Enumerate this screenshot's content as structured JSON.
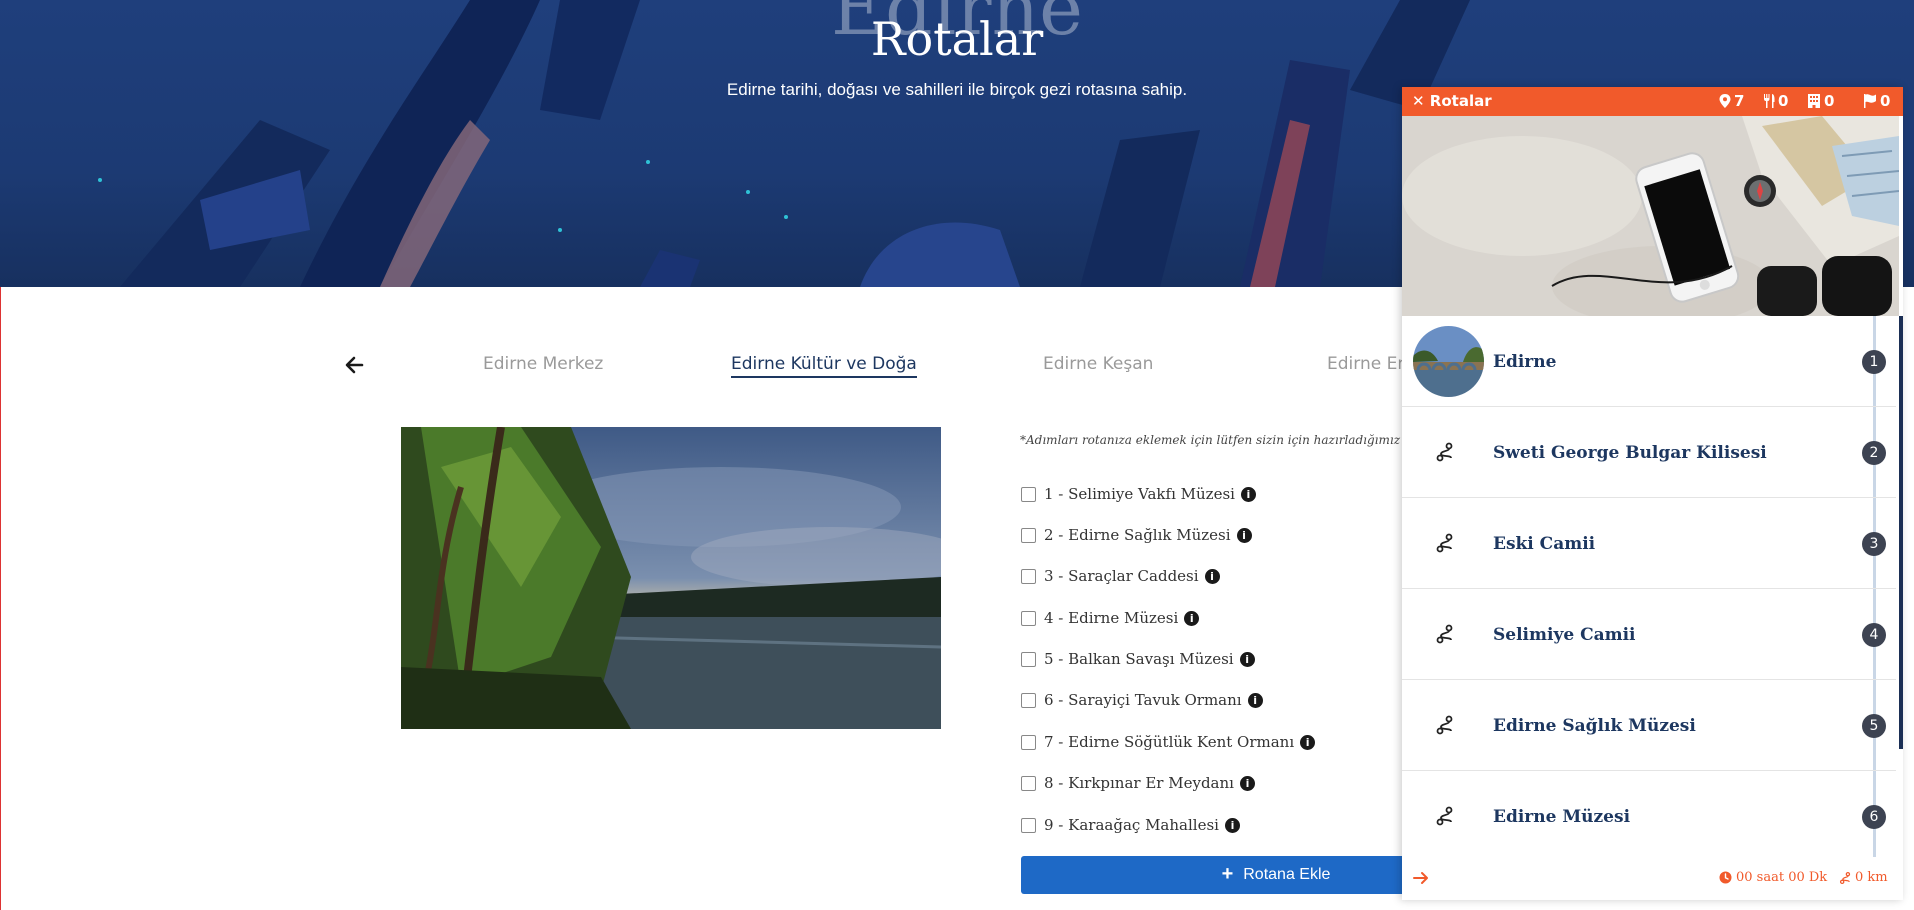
{
  "hero": {
    "bg_text": "Edirne",
    "title": "Rotalar",
    "subtitle": "Edirne tarihi, doğası ve sahilleri ile birçok gezi rotasına sahip."
  },
  "tabs": [
    {
      "label": "Edirne Merkez",
      "active": false
    },
    {
      "label": "Edirne Kültür ve Doğa",
      "active": true
    },
    {
      "label": "Edirne Keşan",
      "active": false
    },
    {
      "label": "Edirne En",
      "active": false
    }
  ],
  "checklist": {
    "note": "*Adımları rotanıza eklemek için lütfen sizin için hazırladığımız listede",
    "steps": [
      "1 - Selimiye Vakfı Müzesi",
      "2 - Edirne Sağlık Müzesi",
      "3 - Saraçlar Caddesi",
      "4 - Edirne Müzesi",
      "5 - Balkan Savaşı Müzesi",
      "6 - Sarayiçi Tavuk Ormanı",
      "7 - Edirne Söğütlük Kent Ormanı",
      "8 - Kırkpınar Er Meydanı",
      "9 - Karaağaç Mahallesi"
    ],
    "info_glyph": "i",
    "add_button": "Rotana Ekle",
    "add_icon": "+"
  },
  "panel": {
    "close_label": "✕ Rotalar",
    "stats": {
      "places": "7",
      "restaurants": "0",
      "hotels": "0",
      "flags": "0"
    },
    "routes": [
      {
        "name": "Edirne",
        "num": "1"
      },
      {
        "name": "Sweti George Bulgar Kilisesi",
        "num": "2"
      },
      {
        "name": "Eski Camii",
        "num": "3"
      },
      {
        "name": "Selimiye Camii",
        "num": "4"
      },
      {
        "name": "Edirne Sağlık Müzesi",
        "num": "5"
      },
      {
        "name": "Edirne Müzesi",
        "num": "6"
      }
    ],
    "footer": {
      "time": "00 saat 00 Dk",
      "distance": "0 km"
    }
  },
  "colors": {
    "accent": "#f15a2b",
    "navy": "#1d3760",
    "button": "#1e69c6"
  }
}
